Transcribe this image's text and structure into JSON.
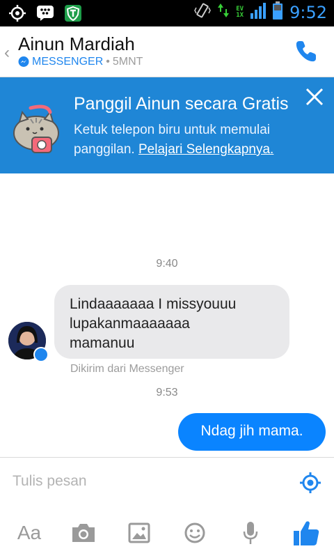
{
  "status": {
    "time": "9:52",
    "net_ev": "EV",
    "net_1x": "1X"
  },
  "header": {
    "contact_name": "Ainun Mardiah",
    "app_label": "MESSENGER",
    "separator": "•",
    "last_active": "5MNT"
  },
  "banner": {
    "title": "Panggil Ainun secara Gratis",
    "text": "Ketuk telepon biru untuk memulai panggilan.",
    "link": "Pelajari Selengkapnya."
  },
  "chat": {
    "time1": "9:40",
    "incoming": "Lindaaaaaaa I missyouuu\nlupakanmaaaaaaa\nmamanuu",
    "sent_from": "Dikirim dari Messenger",
    "time2": "9:53",
    "outgoing": "Ndag jih mama."
  },
  "composer": {
    "placeholder": "Tulis pesan",
    "aa_label": "Aa"
  },
  "colors": {
    "accent": "#1f86ee",
    "banner": "#1f86d6",
    "outgoing_bubble": "#0a84ff",
    "incoming_bubble": "#e9e9eb"
  }
}
